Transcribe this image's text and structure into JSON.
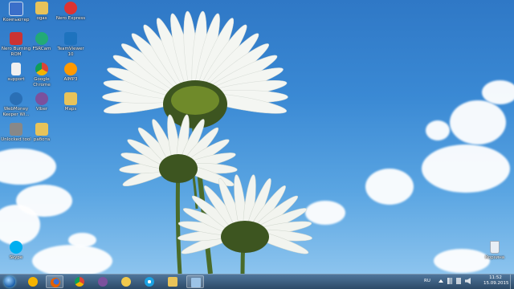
{
  "desktop_icons": [
    {
      "label": "Компьютер",
      "icon": "computer-icon",
      "color": "#3b6fc9"
    },
    {
      "label": "ogas",
      "icon": "folder-icon",
      "color": "#e8c35a"
    },
    {
      "label": "Nero Express",
      "icon": "nero-icon",
      "color": "#d33"
    },
    {
      "label": "Nero Burning ROM",
      "icon": "nero-burn-icon",
      "color": "#c33"
    },
    {
      "label": "FSRCam",
      "icon": "camera-icon",
      "color": "#2a7"
    },
    {
      "label": "TeamViewer 10",
      "icon": "teamviewer-icon",
      "color": "#1e73be"
    },
    {
      "label": "support",
      "icon": "document-icon",
      "color": "#f0f0f0"
    },
    {
      "label": "Google Chrome",
      "icon": "chrome-icon",
      "color": "#e44"
    },
    {
      "label": "AIMP3",
      "icon": "aimp-icon",
      "color": "#f90"
    },
    {
      "label": "WebMoney Keeper Wi...",
      "icon": "webmoney-icon",
      "color": "#2a6fb5"
    },
    {
      "label": "Viber",
      "icon": "viber-icon",
      "color": "#7b519d"
    },
    {
      "label": "Maps",
      "icon": "folder-icon",
      "color": "#e8c35a"
    },
    {
      "label": "Unlocked tool",
      "icon": "tool-icon",
      "color": "#888"
    },
    {
      "label": "работа",
      "icon": "folder-icon",
      "color": "#e8c35a"
    },
    {
      "label": "Skype",
      "icon": "skype-icon",
      "color": "#00aff0"
    }
  ],
  "recycle_bin": {
    "label": "Корзина",
    "icon": "recycle-bin-icon"
  },
  "taskbar": {
    "start": {
      "icon": "windows-start-icon"
    },
    "apps": [
      {
        "icon": "aimp-icon",
        "active": false,
        "color": "#f5b400"
      },
      {
        "icon": "firefox-icon",
        "active": true,
        "color": "#e66000"
      },
      {
        "icon": "chrome-icon",
        "active": false,
        "color": "#db4437"
      },
      {
        "icon": "viber-icon",
        "active": false,
        "color": "#7b519d"
      },
      {
        "icon": "messenger-icon",
        "active": false,
        "color": "#f2c94c"
      },
      {
        "icon": "internet-explorer-icon",
        "active": false,
        "color": "#1ba1e2"
      },
      {
        "icon": "file-explorer-icon",
        "active": false,
        "color": "#e8c35a"
      },
      {
        "icon": "window-icon",
        "active": true,
        "color": "#9cc3e6"
      }
    ],
    "tray": {
      "language": "RU",
      "time": "11:52",
      "date": "15.09.2015"
    }
  }
}
